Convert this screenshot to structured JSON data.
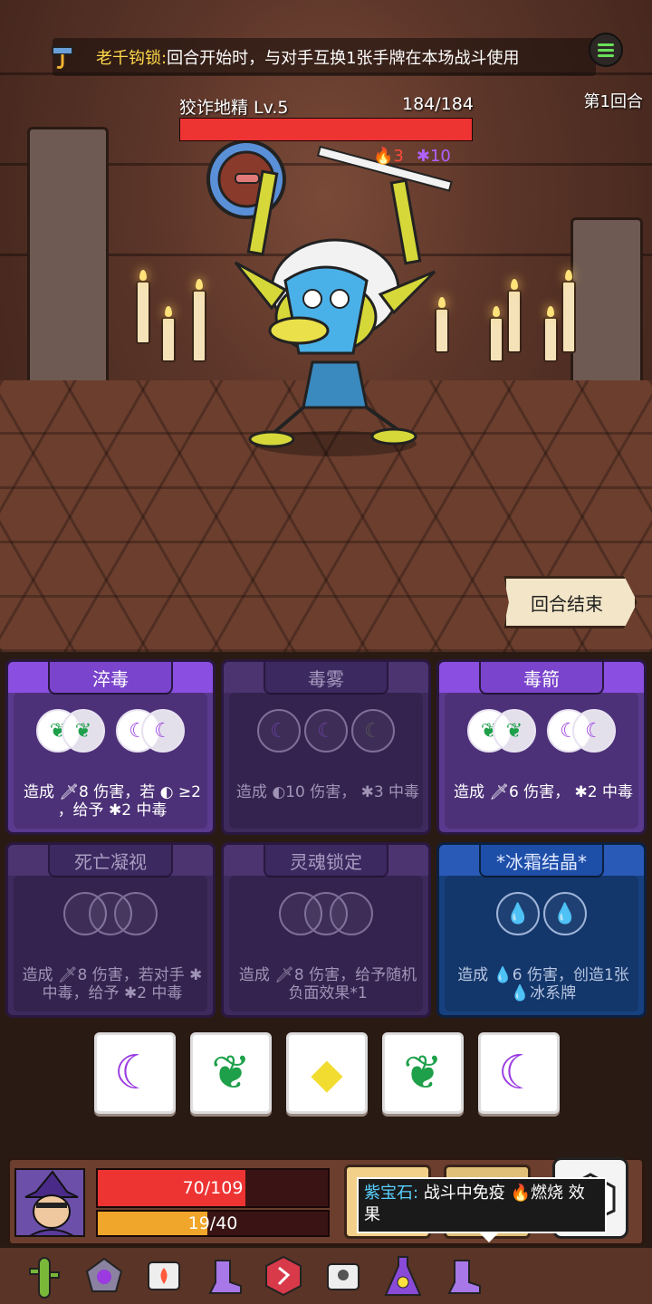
{
  "top_bar": {
    "relic_name": "老千钩锁:",
    "relic_desc": "回合开始时，与对手互换1张手牌在本场战斗使用"
  },
  "round_label": "第1回合",
  "enemy": {
    "name": "狡诈地精  Lv.5",
    "hp_text": "184/184",
    "hp_fraction": 1.0,
    "burn": "3",
    "poison": "10"
  },
  "end_turn_label": "回合结束",
  "cards": [
    {
      "title": "淬毒",
      "desc": "造成 🗡8 伤害，若 ◐ ≥2 ，给予 ✱2 中毒",
      "state": "active"
    },
    {
      "title": "毒雾",
      "desc": "造成 ◐10 伤害， ✱3 中毒",
      "state": "dim"
    },
    {
      "title": "毒箭",
      "desc": "造成 🗡6 伤害， ✱2 中毒",
      "state": "active"
    },
    {
      "title": "死亡凝视",
      "desc": "造成 🗡8 伤害，若对手 ✱ 中毒，给予 ✱2 中毒",
      "state": "dim"
    },
    {
      "title": "灵魂锁定",
      "desc": "造成 🗡8 伤害，给予随机负面效果*1",
      "state": "dim"
    },
    {
      "title": "*冰霜结晶*",
      "desc": "造成 💧6 伤害，创造1张 💧冰系牌",
      "state": "ice"
    }
  ],
  "dice": [
    "moon",
    "leaf",
    "diamond",
    "leaf",
    "moon"
  ],
  "player": {
    "hp_text": "70/109",
    "hp_fraction": 0.642,
    "mana_text": "19/40",
    "mana_fraction": 0.475
  },
  "tooltip": {
    "name": "紫宝石:",
    "text_a": "战斗中免疫",
    "fire_word": "燃烧",
    "text_b": "效果"
  },
  "relics": [
    "cactus-icon",
    "moon-stone-icon",
    "fire-scroll-icon",
    "purple-boot-icon",
    "red-rune-icon",
    "eye-scroll-icon",
    "eye-flask-icon",
    "purple-boot-icon"
  ],
  "colors": {
    "poison": "#b061ff",
    "fire": "#ff4a3a",
    "hp": "#ee3333",
    "mana": "#f0a62a"
  }
}
